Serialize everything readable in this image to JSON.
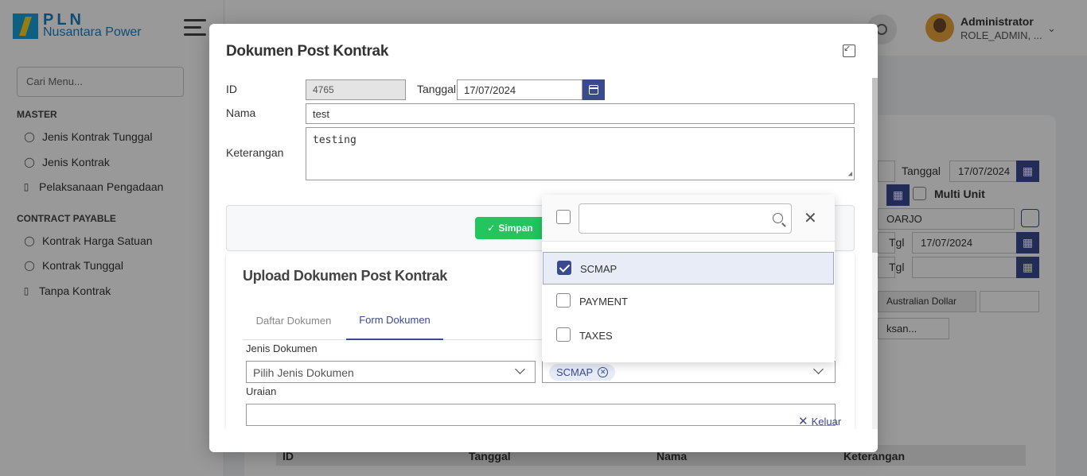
{
  "brand": {
    "line1": "PLN",
    "line2": "Nusantara Power"
  },
  "sidebar": {
    "search_placeholder": "Cari Menu...",
    "sections": [
      {
        "title": "MASTER",
        "items": [
          {
            "label": "Jenis Kontrak Tunggal",
            "icon": "user-icon"
          },
          {
            "label": "Jenis Kontrak",
            "icon": "users-icon"
          },
          {
            "label": "Pelaksanaan Pengadaan",
            "icon": "bookmark-icon"
          }
        ]
      },
      {
        "title": "CONTRACT PAYABLE",
        "items": [
          {
            "label": "Kontrak Harga Satuan",
            "icon": "user-icon"
          },
          {
            "label": "Kontrak Tunggal",
            "icon": "users-icon"
          },
          {
            "label": "Tanpa Kontrak",
            "icon": "bookmark-icon"
          }
        ]
      }
    ]
  },
  "header": {
    "user_name": "Administrator",
    "user_role": "ROLE_ADMIN, ..."
  },
  "background_form": {
    "tanggal_label": "Tanggal",
    "tanggal_value": "17/07/2024",
    "multi_unit_label": "Multi Unit",
    "location_value": "OARJO",
    "tgl_label": "Tgl",
    "tgl_value": "17/07/2024",
    "currency_value": "Australian Dollar",
    "select_partial": "ksan...",
    "table_headers": [
      "ID",
      "Tanggal",
      "Nama",
      "Keterangan"
    ]
  },
  "modal": {
    "title": "Dokumen Post Kontrak",
    "id_label": "ID",
    "id_value": "4765",
    "tanggal_label": "Tanggal",
    "tanggal_value": "17/07/2024",
    "nama_label": "Nama",
    "nama_value": "test",
    "keterangan_label": "Keterangan",
    "keterangan_value": "testing",
    "save_label": "Simpan",
    "exit_label": "Keluar"
  },
  "upload": {
    "title": "Upload Dokumen Post Kontrak",
    "tabs": [
      {
        "label": "Daftar Dokumen",
        "active": false
      },
      {
        "label": "Form Dokumen",
        "active": true
      }
    ],
    "jenis_label": "Jenis Dokumen",
    "jenis_placeholder": "Pilih Jenis Dokumen",
    "uraian_label": "Uraian",
    "selected_chip": "SCMAP"
  },
  "dropdown": {
    "search_value": "",
    "options": [
      {
        "label": "SCMAP",
        "checked": true
      },
      {
        "label": "PAYMENT",
        "checked": false
      },
      {
        "label": "TAXES",
        "checked": false
      }
    ]
  },
  "colors": {
    "primary": "#3b4a8f",
    "success": "#22c55e",
    "brand_blue": "#1a7fc1"
  }
}
